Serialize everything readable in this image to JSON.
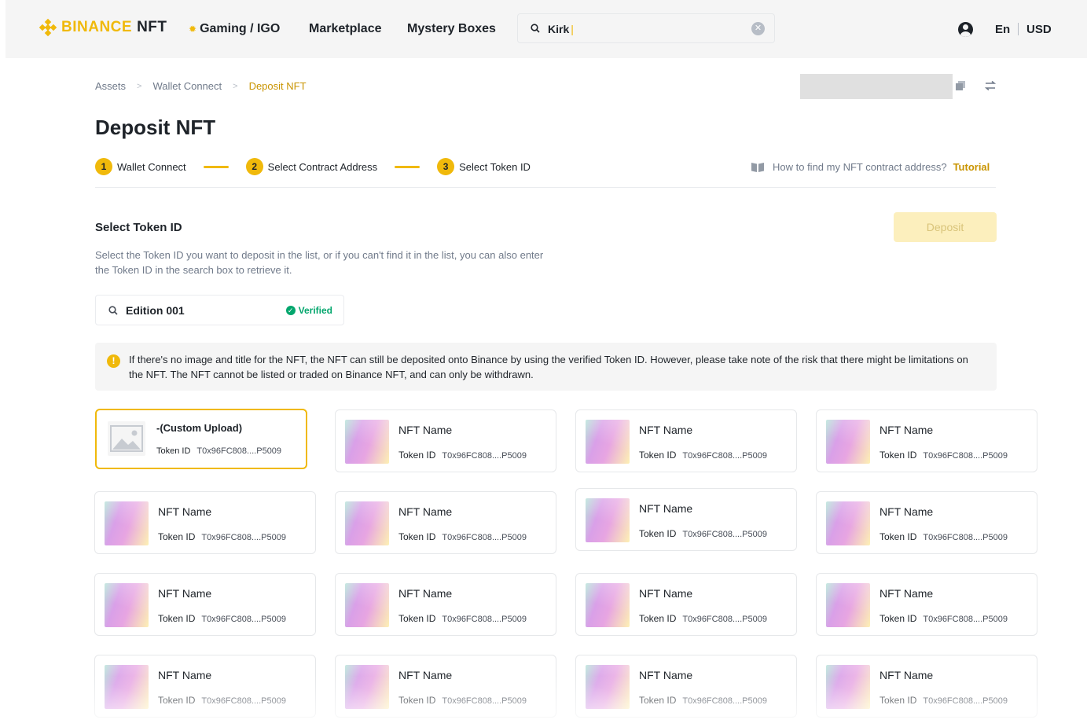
{
  "nav": {
    "brand": "BINANCE",
    "brand_suffix": "NFT",
    "items": [
      {
        "label": "Gaming / IGO"
      },
      {
        "label": "Marketplace"
      },
      {
        "label": "Mystery Boxes"
      }
    ],
    "search_value": "Kirk",
    "language": "En",
    "currency": "USD"
  },
  "breadcrumb": [
    "Assets",
    "Wallet Connect",
    "Deposit NFT"
  ],
  "page_title": "Deposit NFT",
  "steps": [
    {
      "number": "1",
      "label": "Wallet Connect"
    },
    {
      "number": "2",
      "label": "Select Contract Address"
    },
    {
      "number": "3",
      "label": "Select Token ID"
    }
  ],
  "help": {
    "question": "How to find my NFT contract address?",
    "link": "Tutorial"
  },
  "section": {
    "title": "Select Token ID",
    "description": "Select the Token ID you want to deposit in the list, or if you can't find it in the list, you can also enter the Token ID in the search box to retrieve it.",
    "deposit_label": "Deposit",
    "search_value": "Edition 001",
    "verified_label": "Verified"
  },
  "notice": "If there's no image and title for the NFT, the NFT can still be deposited onto Binance by using the verified Token ID. However, please take note of the risk that there might be limitations on the NFT. The NFT cannot be listed or traded on Binance NFT, and can only be withdrawn.",
  "cards": [
    {
      "name": "-(Custom Upload)",
      "token_label": "Token ID",
      "token_id": "T0x96FC808....P5009"
    },
    {
      "name": "NFT Name",
      "token_label": "Token ID",
      "token_id": "T0x96FC808....P5009"
    },
    {
      "name": "NFT Name",
      "token_label": "Token ID",
      "token_id": "T0x96FC808....P5009"
    },
    {
      "name": "NFT Name",
      "token_label": "Token ID",
      "token_id": "T0x96FC808....P5009"
    },
    {
      "name": "NFT Name",
      "token_label": "Token ID",
      "token_id": "T0x96FC808....P5009"
    },
    {
      "name": "NFT Name",
      "token_label": "Token ID",
      "token_id": "T0x96FC808....P5009"
    },
    {
      "name": "NFT Name",
      "token_label": "Token ID",
      "token_id": "T0x96FC808....P5009"
    },
    {
      "name": "NFT Name",
      "token_label": "Token ID",
      "token_id": "T0x96FC808....P5009"
    },
    {
      "name": "NFT Name",
      "token_label": "Token ID",
      "token_id": "T0x96FC808....P5009"
    },
    {
      "name": "NFT Name",
      "token_label": "Token ID",
      "token_id": "T0x96FC808....P5009"
    },
    {
      "name": "NFT Name",
      "token_label": "Token ID",
      "token_id": "T0x96FC808....P5009"
    },
    {
      "name": "NFT Name",
      "token_label": "Token ID",
      "token_id": "T0x96FC808....P5009"
    },
    {
      "name": "NFT Name",
      "token_label": "Token ID",
      "token_id": "T0x96FC808....P5009"
    },
    {
      "name": "NFT Name",
      "token_label": "Token ID",
      "token_id": "T0x96FC808....P5009"
    },
    {
      "name": "NFT Name",
      "token_label": "Token ID",
      "token_id": "T0x96FC808....P5009"
    },
    {
      "name": "NFT Name",
      "token_label": "Token ID",
      "token_id": "T0x96FC808....P5009"
    }
  ],
  "colors": {
    "accent": "#F0B90B",
    "link": "#C99400",
    "verified": "#03A66D",
    "deposit_disabled": "#FCEFBD"
  }
}
